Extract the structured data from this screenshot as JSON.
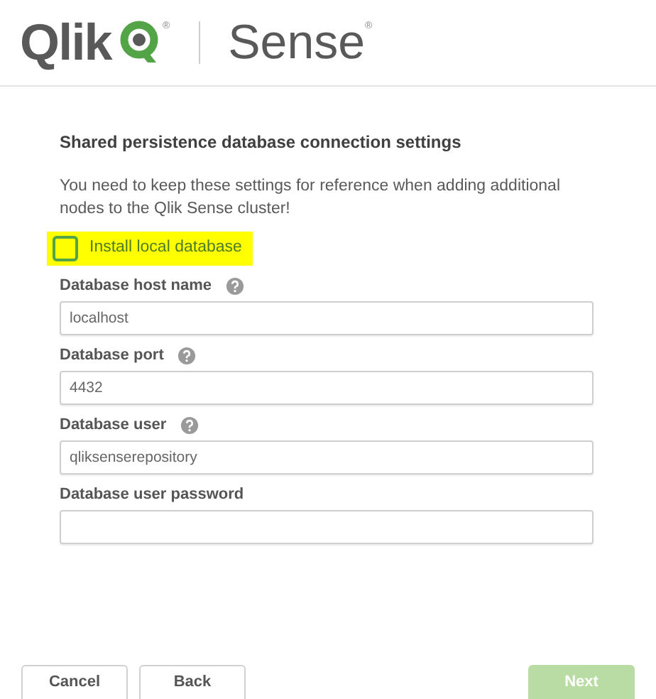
{
  "header": {
    "logo_text": "Qlik",
    "logo_mark": "®",
    "product": "Sense",
    "product_mark": "®"
  },
  "form": {
    "title": "Shared persistence database connection settings",
    "description": "You need to keep these settings for reference when adding additional nodes to the Qlik Sense cluster!",
    "install_local": {
      "label": "Install local database",
      "checked": false,
      "highlighted": true
    },
    "fields": [
      {
        "label": "Database host name",
        "help": true,
        "value": "localhost"
      },
      {
        "label": "Database port",
        "help": true,
        "value": "4432"
      },
      {
        "label": "Database user",
        "help": true,
        "value": "qliksenserepository"
      },
      {
        "label": "Database user password",
        "help": false
      }
    ]
  },
  "buttons": [
    {
      "label": "Cancel",
      "kind": "secondary",
      "disabled": false
    },
    {
      "label": "Back",
      "kind": "secondary",
      "disabled": false
    },
    {
      "label": "Next",
      "kind": "primary",
      "disabled": true
    }
  ]
}
